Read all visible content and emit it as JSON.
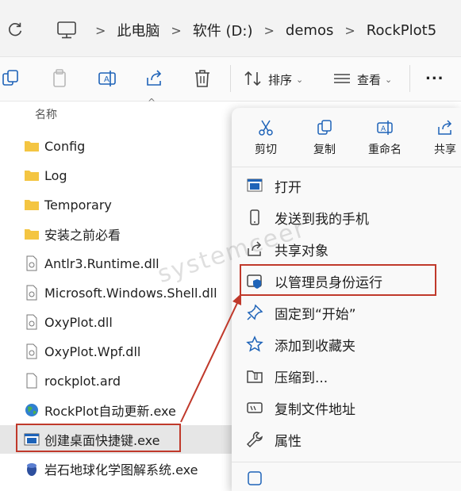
{
  "address_bar": {
    "crumbs": [
      "此电脑",
      "软件 (D:)",
      "demos",
      "RockPlot5"
    ]
  },
  "toolbar": {
    "sort_label": "排序",
    "view_label": "查看",
    "more_label": "..."
  },
  "column_header": {
    "name_label": "名称"
  },
  "files": [
    {
      "name": "Config",
      "icon": "folder-icon"
    },
    {
      "name": "Log",
      "icon": "folder-icon"
    },
    {
      "name": "Temporary",
      "icon": "folder-icon"
    },
    {
      "name": "安装之前必看",
      "icon": "folder-icon"
    },
    {
      "name": "Antlr3.Runtime.dll",
      "icon": "dll-file-icon"
    },
    {
      "name": "Microsoft.Windows.Shell.dll",
      "icon": "dll-file-icon"
    },
    {
      "name": "OxyPlot.dll",
      "icon": "dll-file-icon"
    },
    {
      "name": "OxyPlot.Wpf.dll",
      "icon": "dll-file-icon"
    },
    {
      "name": "rockplot.ard",
      "icon": "blank-file-icon"
    },
    {
      "name": "RockPlot自动更新.exe",
      "icon": "globe-icon"
    },
    {
      "name": "创建桌面快捷键.exe",
      "icon": "app-window-icon"
    },
    {
      "name": "岩石地球化学图解系统.exe",
      "icon": "app-icon"
    }
  ],
  "context_menu": {
    "quick_actions": [
      "剪切",
      "复制",
      "重命名",
      "共享"
    ],
    "items": [
      "打开",
      "发送到我的手机",
      "共享对象",
      "以管理员身份运行",
      "固定到“开始”",
      "添加到收藏夹",
      "压缩到...",
      "复制文件地址",
      "属性"
    ]
  },
  "watermark": "systemceer",
  "colors": {
    "highlight_border": "#c0392b",
    "folder": "#f4c542",
    "selection": "#e6e6e6",
    "accent": "#1e63b8"
  }
}
